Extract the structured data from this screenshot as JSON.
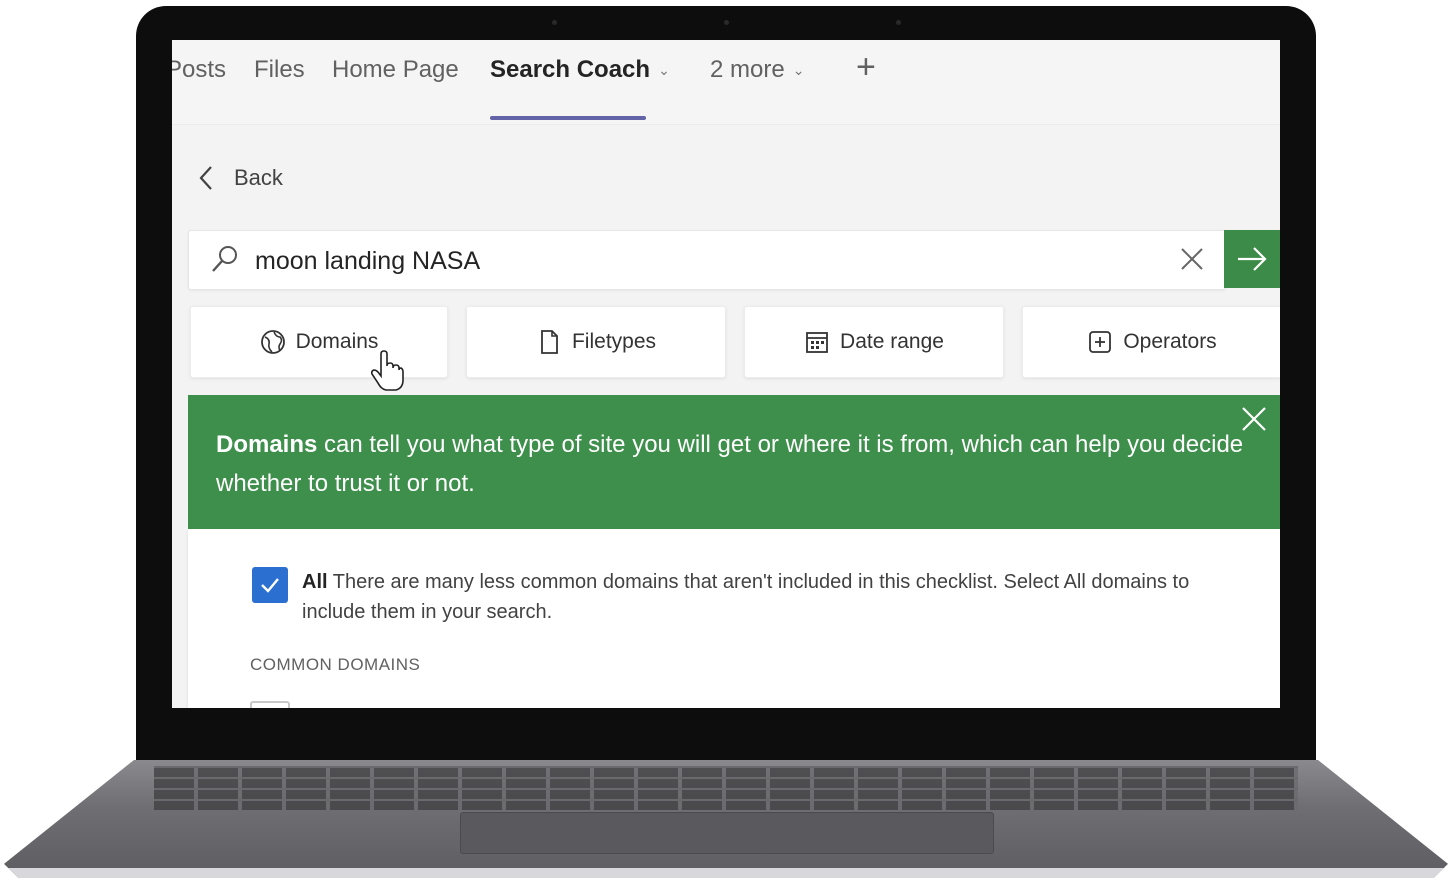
{
  "tabs": {
    "items": [
      {
        "label": "Posts"
      },
      {
        "label": "Files"
      },
      {
        "label": "Home Page"
      },
      {
        "label": "Search Coach"
      },
      {
        "label": "2 more"
      }
    ],
    "add_icon": "plus-icon"
  },
  "nav": {
    "back_label": "Back"
  },
  "search": {
    "value": "moon landing NASA",
    "search_icon": "search-icon",
    "clear_icon": "close-icon",
    "submit_icon": "arrow-right-icon"
  },
  "filters": [
    {
      "label": "Domains",
      "icon": "globe-icon"
    },
    {
      "label": "Filetypes",
      "icon": "file-icon"
    },
    {
      "label": "Date range",
      "icon": "calendar-icon"
    },
    {
      "label": "Operators",
      "icon": "plus-box-icon"
    }
  ],
  "banner": {
    "bold": "Domains",
    "text": " can tell you what type of site you will get or where it is from, which can help you decide whether to trust it or not."
  },
  "domains": {
    "all_label": "All",
    "all_description": " There are many less common domains that aren't included in this checklist. Select All domains to include them in your search.",
    "all_checked": true,
    "section_heading": "COMMON DOMAINS"
  },
  "colors": {
    "accent": "#6264a7",
    "banner": "#3e8f4c",
    "go_button": "#3d8b48",
    "checkbox": "#2b6fd1"
  }
}
